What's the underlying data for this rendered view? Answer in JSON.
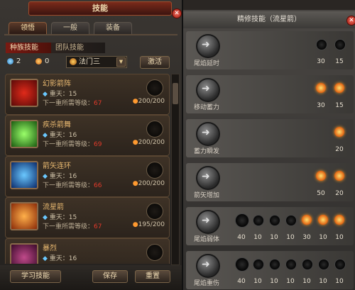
{
  "window": {
    "title": "技能"
  },
  "main_tabs": [
    {
      "label": "领悟",
      "active": true
    },
    {
      "label": "一般",
      "active": false
    },
    {
      "label": "装备",
      "active": false
    }
  ],
  "sub_tabs": [
    {
      "label": "种族技能",
      "active": true
    },
    {
      "label": "团队技能",
      "active": false
    }
  ],
  "stats": {
    "blue_points": "2",
    "orange_points": "0"
  },
  "class_select": {
    "value": "法门三"
  },
  "activate_label": "激活",
  "skills": [
    {
      "name": "幻影箭阵",
      "level": "重天：15",
      "req_label": "下一重所需等级：",
      "req_level": "67",
      "points": "200/200"
    },
    {
      "name": "疾杀箭舞",
      "level": "重天：16",
      "req_label": "下一重所需等级：",
      "req_level": "69",
      "points": "200/200"
    },
    {
      "name": "箭矢连环",
      "level": "重天：16",
      "req_label": "下一重所需等级：",
      "req_level": "66",
      "points": "200/200"
    },
    {
      "name": "流星箭",
      "level": "重天：15",
      "req_label": "下一重所需等级：",
      "req_level": "67",
      "points": "195/200"
    },
    {
      "name": "暴烈",
      "level": "重天：16"
    }
  ],
  "bottom_buttons": {
    "learn": "学习技能",
    "save": "保存",
    "reset": "重置"
  },
  "detail": {
    "title": "精修技能（流星箭）",
    "rows": [
      {
        "name": "尾焰延时",
        "runes": [
          {
            "value": "30",
            "active": false
          },
          {
            "value": "15",
            "active": false
          }
        ]
      },
      {
        "name": "移动蓄力",
        "runes": [
          {
            "value": "30",
            "active": true
          },
          {
            "value": "15",
            "active": true
          }
        ]
      },
      {
        "name": "蓄力瞬发",
        "runes": [
          {
            "value": "20",
            "active": true
          }
        ]
      },
      {
        "name": "箭矢增加",
        "runes": [
          {
            "value": "50",
            "active": true
          },
          {
            "value": "20",
            "active": true
          }
        ]
      },
      {
        "name": "尾焰弱体",
        "runes": [
          {
            "value": "40",
            "active": false
          },
          {
            "value": "10",
            "active": false
          },
          {
            "value": "10",
            "active": false
          },
          {
            "value": "10",
            "active": false
          },
          {
            "value": "30",
            "active": true
          },
          {
            "value": "10",
            "active": true
          },
          {
            "value": "10",
            "active": true
          }
        ]
      },
      {
        "name": "尾焰重伤",
        "runes": [
          {
            "value": "40",
            "active": false
          },
          {
            "value": "10",
            "active": false
          },
          {
            "value": "10",
            "active": false
          },
          {
            "value": "10",
            "active": false
          },
          {
            "value": "10",
            "active": false
          },
          {
            "value": "10",
            "active": false
          },
          {
            "value": "10",
            "active": false
          }
        ]
      }
    ]
  },
  "colors": {
    "accent_red": "#7a1a12",
    "required_level": "#e03a2a",
    "rune_active": "#ff9a20"
  }
}
